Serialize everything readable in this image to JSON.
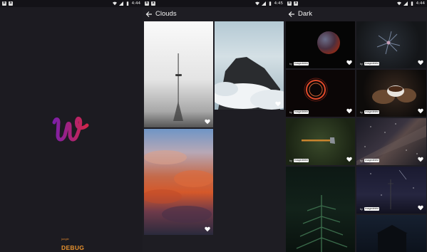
{
  "screens": [
    {
      "status": {
        "time": "4:44",
        "notif": [
          "b",
          "a"
        ]
      },
      "splash": {
        "badge_small": "jungle",
        "badge_big": "DEBUG",
        "logo_colors": [
          "#7d1fa8",
          "#d0264a"
        ]
      }
    },
    {
      "status": {
        "time": "4:45",
        "notif": [
          "b",
          "a"
        ]
      },
      "title": "Clouds",
      "tiles": [
        {
          "name": "cn-tower-fog"
        },
        {
          "name": "mountain-clouds"
        },
        {
          "name": "sunset-clouds"
        }
      ]
    },
    {
      "status": {
        "time": "4:44",
        "notif": [
          "b",
          "a"
        ]
      },
      "title": "Dark",
      "credit_by": "by",
      "tiles": [
        {
          "name": "moon-eclipse",
          "credit": "imagedelete"
        },
        {
          "name": "dark-flower",
          "credit": "imagedelete"
        },
        {
          "name": "light-ring",
          "credit": "imagedelete"
        },
        {
          "name": "cup-hands",
          "credit": "imagedelete"
        },
        {
          "name": "axe-grass",
          "credit": "imagedelete"
        },
        {
          "name": "milky-way",
          "credit": "imagedelete"
        },
        {
          "name": "pine-tree",
          "credit": ""
        },
        {
          "name": "star-trails",
          "credit": "imagedelete"
        },
        {
          "name": "night-house",
          "credit": ""
        }
      ]
    }
  ],
  "colors": {
    "background": "#1e1d23",
    "statusbar": "#131217",
    "heart": "#ffffff"
  }
}
